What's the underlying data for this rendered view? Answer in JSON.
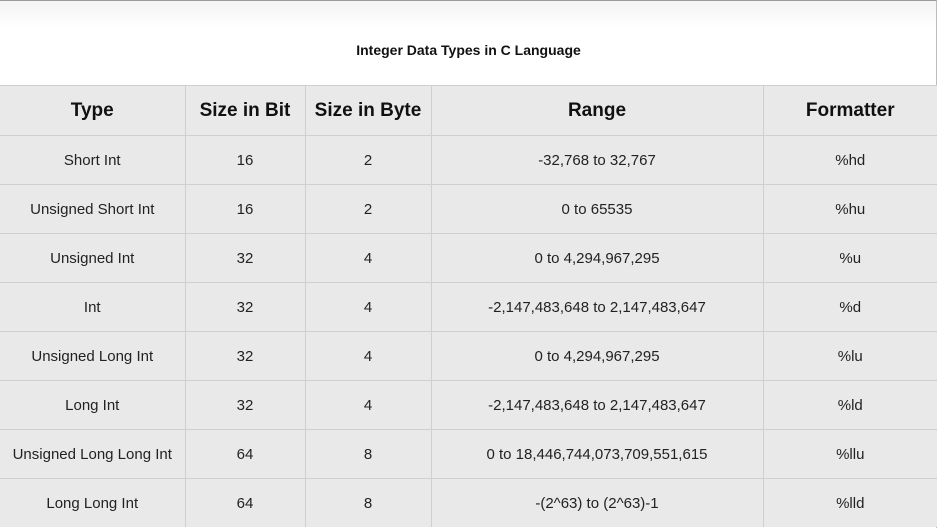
{
  "title": "Integer Data Types in C Language",
  "table": {
    "headers": [
      "Type",
      "Size in Bit",
      "Size in Byte",
      "Range",
      "Formatter"
    ],
    "rows": [
      [
        "Short Int",
        "16",
        "2",
        "-32,768 to 32,767",
        "%hd"
      ],
      [
        "Unsigned Short Int",
        "16",
        "2",
        "0 to 65535",
        "%hu"
      ],
      [
        "Unsigned Int",
        "32",
        "4",
        "0 to 4,294,967,295",
        "%u"
      ],
      [
        "Int",
        "32",
        "4",
        "-2,147,483,648 to 2,147,483,647",
        "%d"
      ],
      [
        "Unsigned Long Int",
        "32",
        "4",
        "0 to 4,294,967,295",
        "%lu"
      ],
      [
        "Long Int",
        "32",
        "4",
        "-2,147,483,648 to 2,147,483,647",
        "%ld"
      ],
      [
        "Unsigned Long Long Int",
        "64",
        "8",
        "0 to 18,446,744,073,709,551,615",
        "%llu"
      ],
      [
        "Long Long Int",
        "64",
        "8",
        "-(2^63) to (2^63)-1",
        "%lld"
      ]
    ]
  }
}
